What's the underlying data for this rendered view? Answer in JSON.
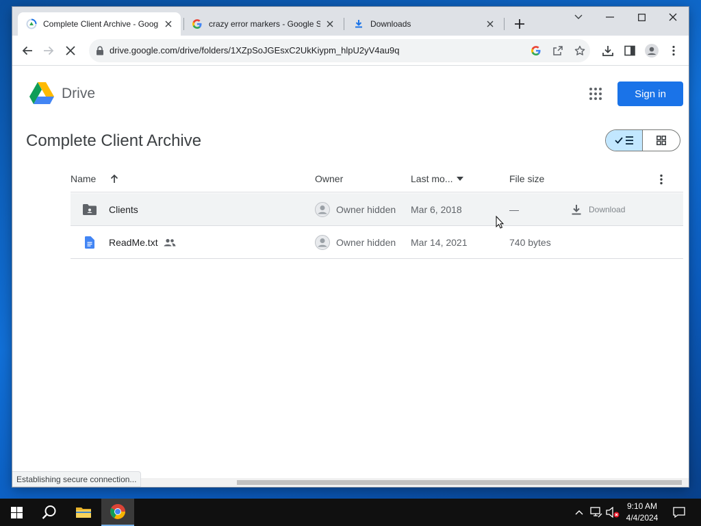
{
  "browser": {
    "tabs": [
      {
        "title": "Complete Client Archive - Google Drive",
        "icon": "drive-loading-icon",
        "active": true
      },
      {
        "title": "crazy error markers - Google Search",
        "icon": "google-g-icon",
        "active": false
      },
      {
        "title": "Downloads",
        "icon": "download-icon",
        "active": false
      }
    ],
    "url": "drive.google.com/drive/folders/1XZpSoJGEsxC2UkKiypm_hlpU2yV4au9q",
    "status_text": "Establishing secure connection..."
  },
  "drive": {
    "brand": "Drive",
    "sign_in_label": "Sign in",
    "folder_title": "Complete Client Archive",
    "columns": {
      "name": "Name",
      "owner": "Owner",
      "last_modified": "Last mo...",
      "file_size": "File size"
    },
    "rows": [
      {
        "name": "Clients",
        "type": "folder",
        "owner": "Owner hidden",
        "modified": "Mar 6, 2018",
        "size": "—",
        "action": "Download",
        "shared": false
      },
      {
        "name": "ReadMe.txt",
        "type": "document",
        "owner": "Owner hidden",
        "modified": "Mar 14, 2021",
        "size": "740 bytes",
        "shared": true
      }
    ],
    "accent_color": "#1a73e8"
  },
  "taskbar": {
    "time": "9:10 AM",
    "date": "4/4/2024"
  }
}
